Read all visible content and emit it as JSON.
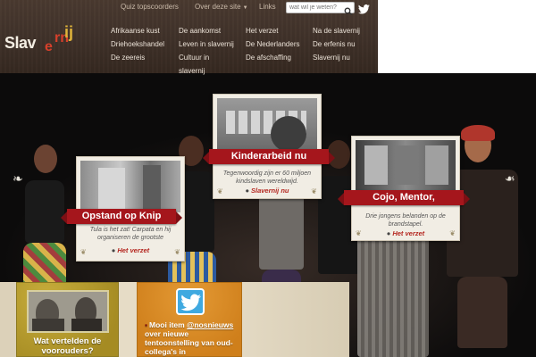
{
  "topnav": {
    "quiz": "Quiz topscoorders",
    "about": "Over deze site",
    "links": "Links"
  },
  "search": {
    "placeholder": "wat wil je weten?"
  },
  "logo": {
    "part1": "Slav",
    "part2": "e",
    "part3": "rn",
    "part4": "ij"
  },
  "menu": {
    "col1": [
      "Afrikaanse kust",
      "Driehoekshandel",
      "De zeereis"
    ],
    "col2": [
      "De aankomst",
      "Leven in slavernij",
      "Cultuur in",
      "slavernij"
    ],
    "col3": [
      "Het verzet",
      "De Nederlanders",
      "De afschaffing"
    ],
    "col4": [
      "Na de slavernij",
      "De erfenis nu",
      "Slavernij nu"
    ]
  },
  "cards": [
    {
      "title": "Opstand op Knip",
      "desc": "Tula is het zat! Carpata en hij organiseren de grootste",
      "link": "Het verzet"
    },
    {
      "title": "Kinderarbeid nu",
      "desc": "Tegenwoordig zijn er 60 miljoen kindslaven wereldwijd.",
      "link": "Slavernij nu"
    },
    {
      "title": "Cojo, Mentor,",
      "desc": "Drie jongens belanden op de brandstapel.",
      "link": "Het verzet"
    }
  ],
  "panels": {
    "vooroud_title": "Wat vertelden de voorouders?",
    "tweet_prefix": "Mooi item ",
    "tweet_handle": "@nos",
    "tweet_handle2": "nieuws",
    "tweet_rest": " over nieuwe tentoonstelling van oud-collega's in"
  },
  "colors": {
    "header_bg": "#3f3129",
    "ribbon_red": "#a5161c",
    "link_red": "#b4261f",
    "panel_gold": "#b39a2c",
    "panel_orange": "#d88a24",
    "twitter_blue": "#3fa9e0"
  }
}
